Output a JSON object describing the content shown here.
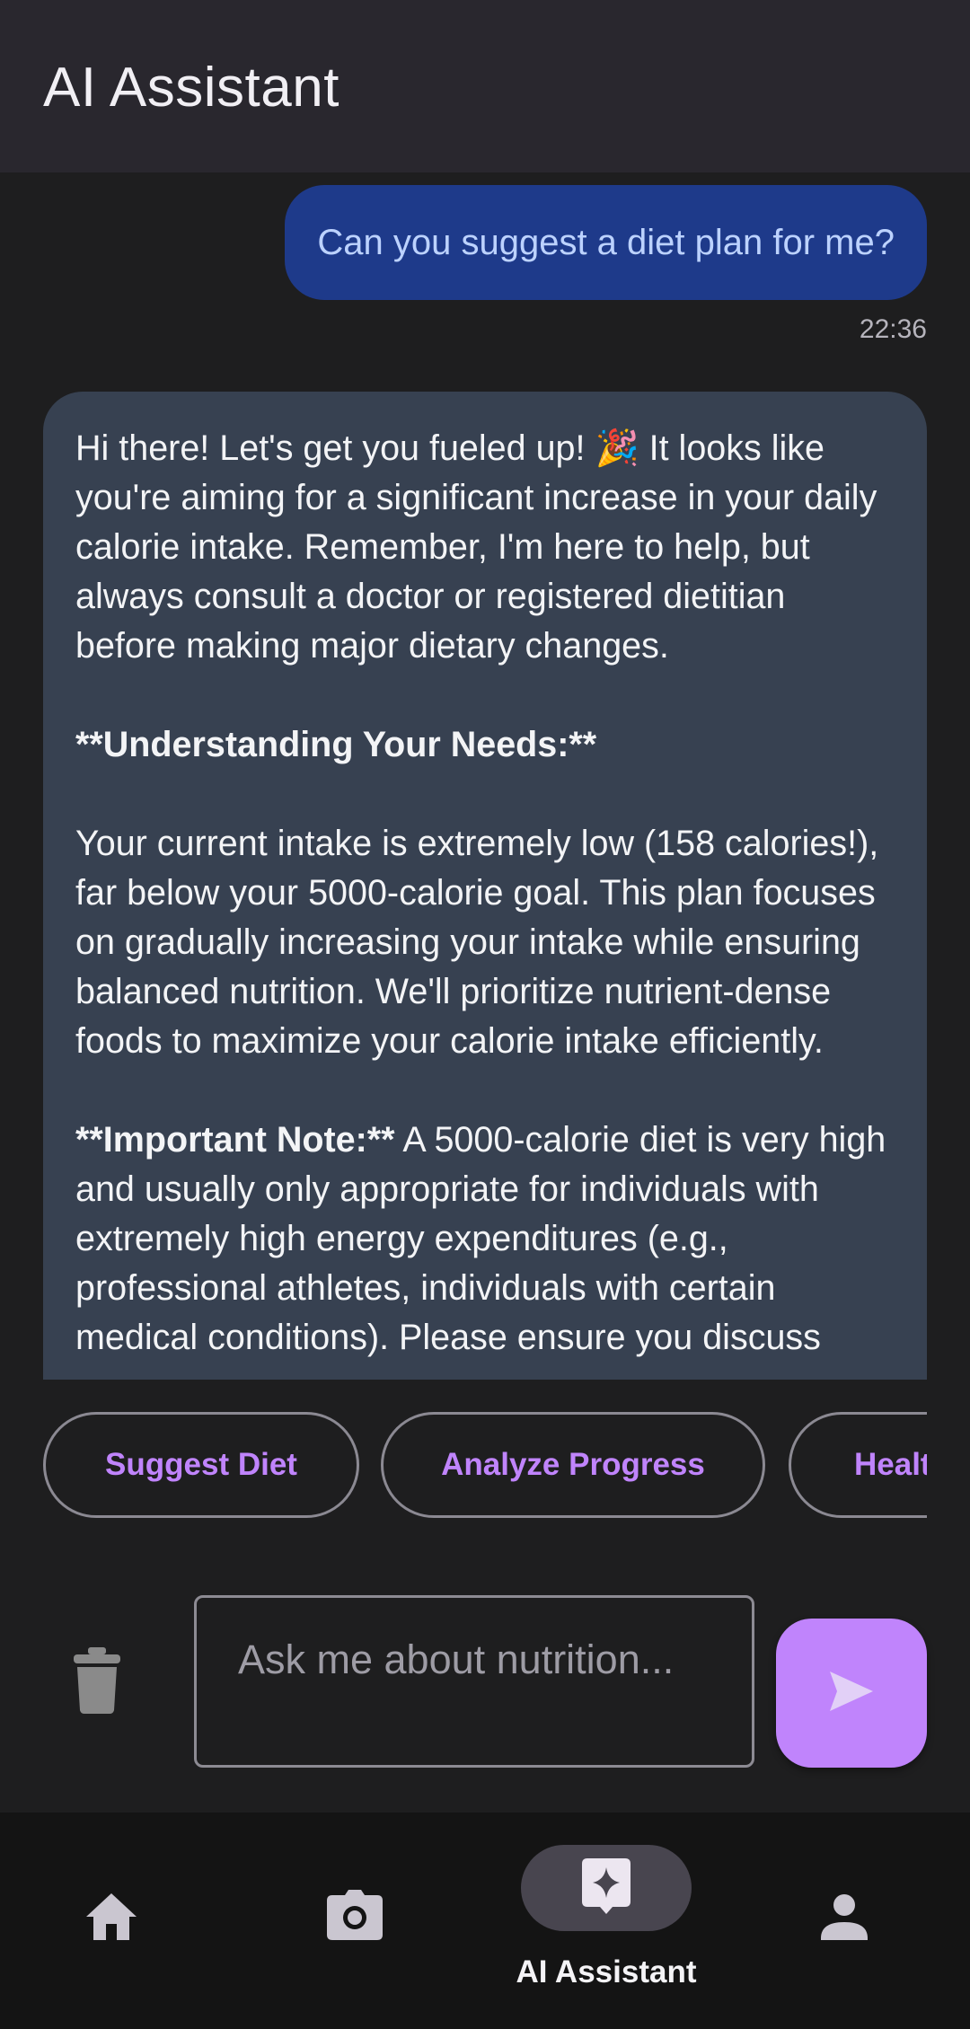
{
  "app_bar": {
    "title": "AI Assistant"
  },
  "chat": {
    "user_message": {
      "text": "Can you suggest a diet plan for me?",
      "time": "22:36"
    },
    "ai_message": {
      "para1": "Hi there!  Let's get you fueled up! 🎉  It looks like you're aiming for a significant increase in your daily calorie intake.  Remember, I'm here to help, but always consult a doctor or registered dietitian before making major dietary changes.",
      "heading1": "**Understanding Your Needs:**",
      "para2": "Your current intake is extremely low (158 calories!), far below your 5000-calorie goal.  This plan focuses on gradually increasing your intake while ensuring balanced nutrition.  We'll prioritize nutrient-dense foods to maximize your calorie intake efficiently.",
      "note_label": "**Important Note:**",
      "note_text": " A 5000-calorie diet is very high and usually only appropriate for individuals with extremely high energy expenditures (e.g., professional athletes, individuals with certain medical conditions).  Please ensure you discuss"
    }
  },
  "chips": [
    {
      "label": "Suggest Diet"
    },
    {
      "label": "Analyze Progress"
    },
    {
      "label": "Health"
    }
  ],
  "composer": {
    "placeholder": "Ask me about nutrition...",
    "trash_icon": "trash-icon",
    "send_icon": "send-icon"
  },
  "bottom_nav": {
    "items": [
      {
        "icon": "home-icon",
        "label": ""
      },
      {
        "icon": "camera-icon",
        "label": ""
      },
      {
        "icon": "ai-sparkle-icon",
        "label": "AI Assistant"
      },
      {
        "icon": "profile-icon",
        "label": ""
      }
    ]
  },
  "colors": {
    "accent": "#c084fc",
    "user_bubble": "#1e3a8a",
    "ai_bubble": "#374151",
    "background": "#1e1e1f",
    "topbar": "#29272e"
  }
}
